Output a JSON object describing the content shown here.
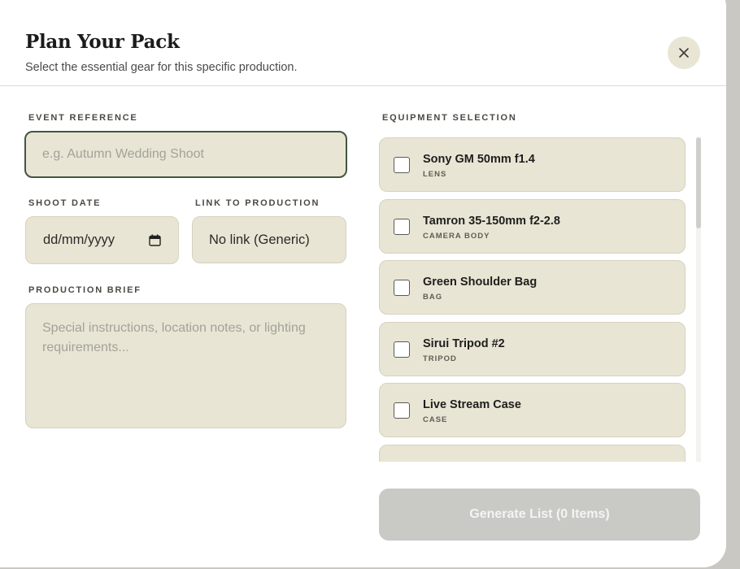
{
  "header": {
    "title": "Plan Your Pack",
    "subtitle": "Select the essential gear for this specific production."
  },
  "form": {
    "event_reference": {
      "label": "EVENT REFERENCE",
      "placeholder": "e.g. Autumn Wedding Shoot",
      "value": ""
    },
    "shoot_date": {
      "label": "SHOOT DATE",
      "value": "dd/mm/yyyy"
    },
    "link_to_production": {
      "label": "LINK TO PRODUCTION",
      "value": "No link (Generic)"
    },
    "production_brief": {
      "label": "PRODUCTION BRIEF",
      "placeholder": "Special instructions, location notes, or lighting requirements..."
    }
  },
  "equipment": {
    "label": "EQUIPMENT SELECTION",
    "items": [
      {
        "name": "Sony GM 50mm f1.4",
        "category": "LENS",
        "checked": false
      },
      {
        "name": "Tamron 35-150mm f2-2.8",
        "category": "CAMERA BODY",
        "checked": false
      },
      {
        "name": "Green Shoulder Bag",
        "category": "BAG",
        "checked": false
      },
      {
        "name": "Sirui Tripod #2",
        "category": "TRIPOD",
        "checked": false
      },
      {
        "name": "Live Stream Case",
        "category": "CASE",
        "checked": false
      }
    ]
  },
  "actions": {
    "generate_label": "Generate List (0 Items)"
  },
  "icons": {
    "close": "close-icon",
    "calendar": "calendar-icon"
  },
  "colors": {
    "field_bg": "#e9e5d4",
    "focus_border": "#41573f",
    "disabled_button": "#c9c9c6"
  }
}
